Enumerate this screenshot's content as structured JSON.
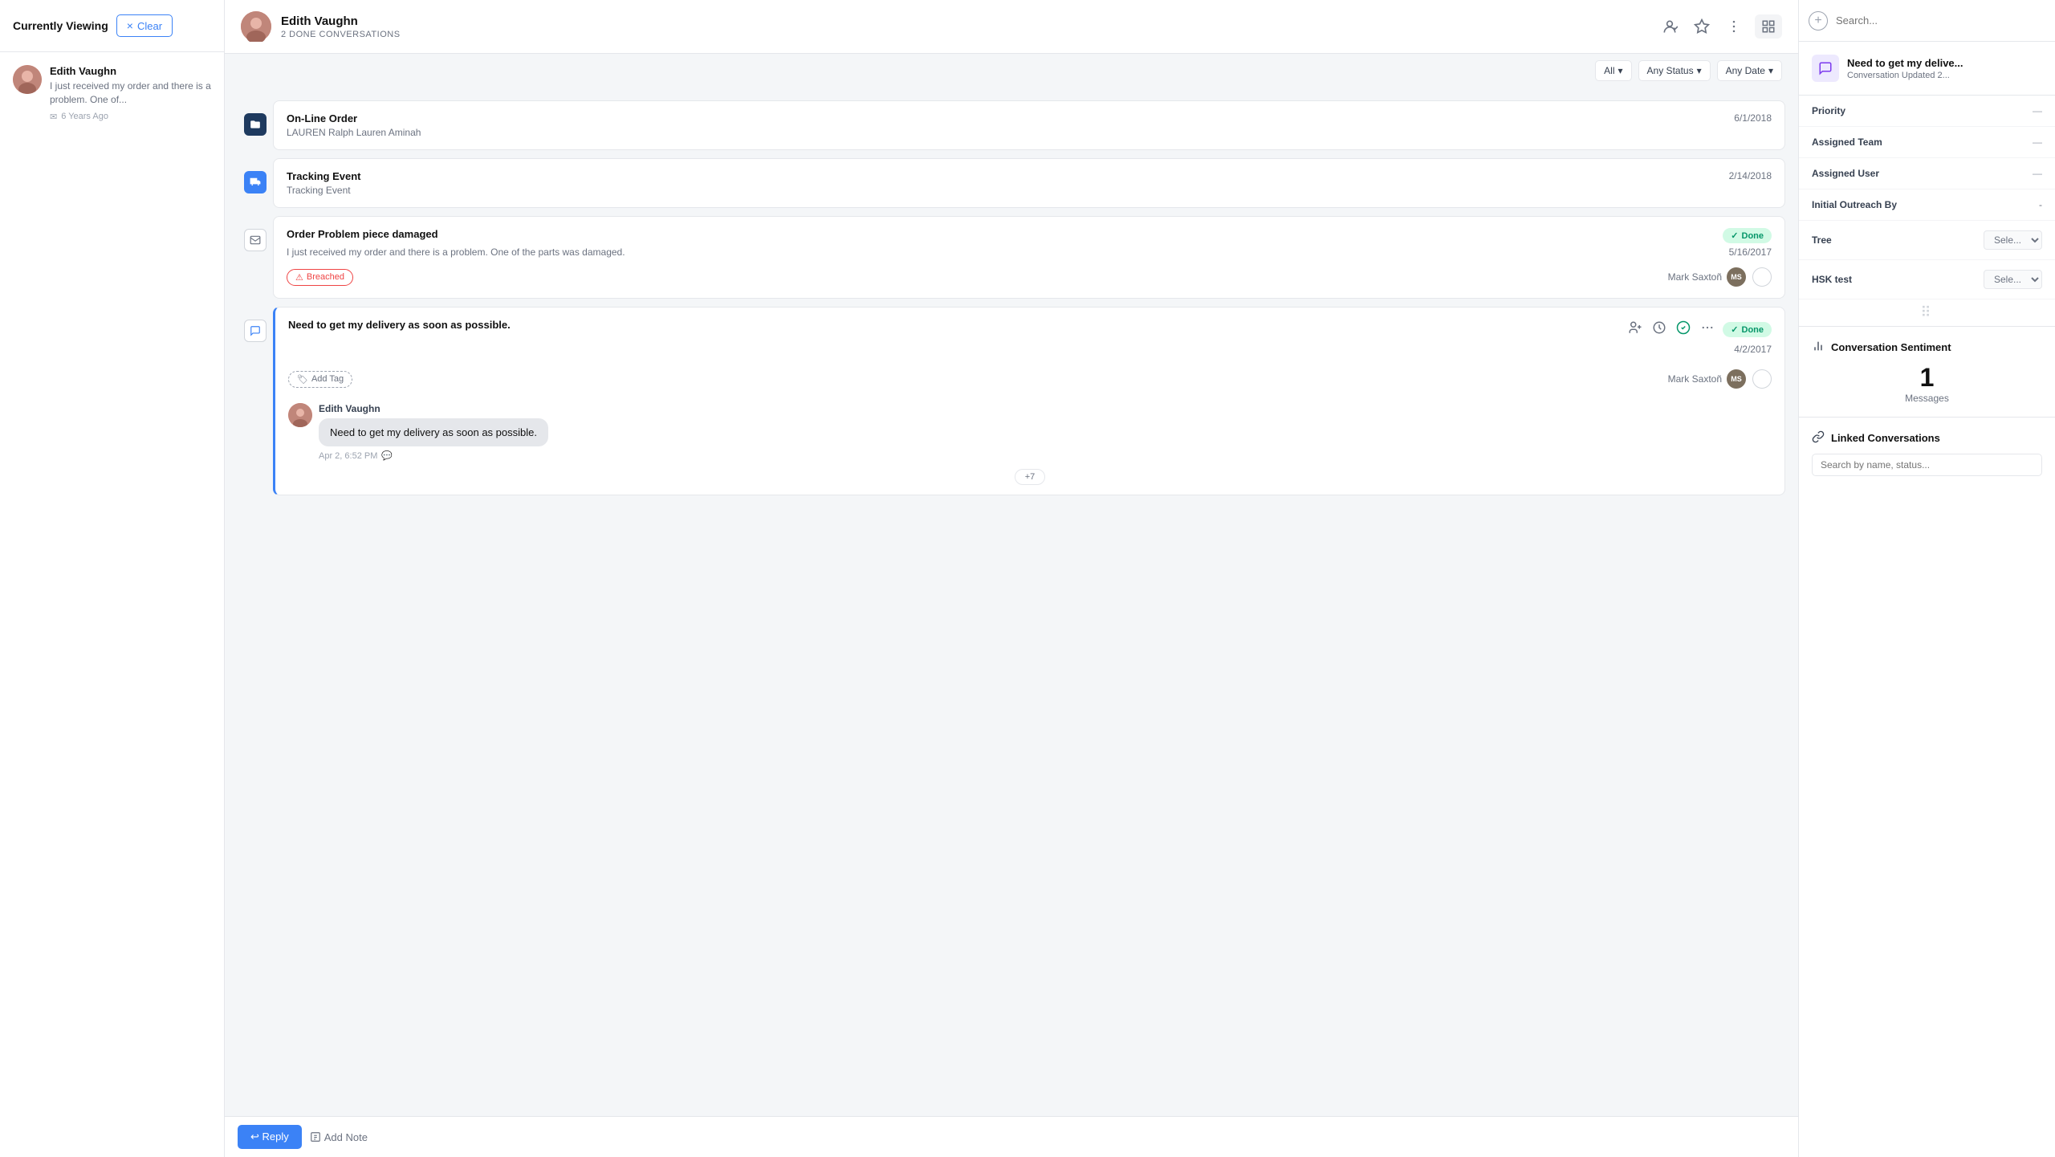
{
  "app": {
    "title": "Currently Viewing"
  },
  "header": {
    "clear_label": "Clear",
    "contact_name": "Edith Vaughn",
    "conversations_count": "2 DONE CONVERSATIONS"
  },
  "sidebar": {
    "contact": {
      "name": "Edith Vaughn",
      "preview": "I just received my order and there is a problem. One of...",
      "time": "6 Years Ago"
    }
  },
  "filters": {
    "all_label": "All",
    "status_label": "Any Status",
    "date_label": "Any Date"
  },
  "conversations": [
    {
      "id": "conv-1",
      "title": "On-Line Order",
      "subtitle": "LAUREN Ralph Lauren Aminah",
      "date": "6/1/2018",
      "type": "folder",
      "done": false,
      "breached": false
    },
    {
      "id": "conv-2",
      "title": "Tracking Event",
      "subtitle": "Tracking Event",
      "date": "2/14/2018",
      "type": "truck",
      "done": false,
      "breached": false
    },
    {
      "id": "conv-3",
      "title": "Order Problem piece damaged",
      "subtitle": "",
      "body": "I just received my order and there is a problem. One of the parts was damaged.",
      "date": "5/16/2017",
      "type": "mail",
      "done": true,
      "done_label": "Done",
      "breached": true,
      "breached_label": "Breached",
      "agent_name": "Mark Saxtoñ",
      "agent_initials": "MS"
    },
    {
      "id": "conv-4",
      "title": "Need to get my delivery as soon as possible.",
      "subtitle": "",
      "date": "4/2/2017",
      "type": "chat",
      "done": true,
      "done_label": "Done",
      "breached": false,
      "agent_name": "Mark Saxtoñ",
      "agent_initials": "MS",
      "active": true,
      "add_tag_label": "Add Tag",
      "message": {
        "sender": "Edith Vaughn",
        "text": "Need to get my delivery as soon as possible.",
        "time": "Apr 2, 6:52 PM",
        "more_count": "+7"
      }
    }
  ],
  "right_panel": {
    "conv_title": "Need to get my delive...",
    "conv_subtitle": "Conversation Updated 2...",
    "fields": {
      "priority_label": "Priority",
      "priority_value": "",
      "assigned_team_label": "Assigned Team",
      "assigned_team_value": "",
      "assigned_user_label": "Assigned User",
      "assigned_user_value": "",
      "initial_outreach_label": "Initial Outreach By",
      "initial_outreach_value": "-",
      "tree_label": "Tree",
      "tree_value": "Sele...",
      "hsk_test_label": "HSK test",
      "hsk_test_value": "Sele..."
    },
    "sentiment": {
      "label": "Conversation Sentiment",
      "count": "1",
      "messages_label": "Messages"
    },
    "linked": {
      "label": "Linked Conversations",
      "search_placeholder": "Search by name, status..."
    }
  },
  "search": {
    "placeholder": "Search..."
  },
  "icons": {
    "folder": "📁",
    "truck": "🚚",
    "mail": "✉",
    "chat": "💬",
    "tag": "🏷",
    "link": "🔗",
    "chart": "📊",
    "check": "✓",
    "clock": "⏰",
    "alert": "⚠"
  }
}
